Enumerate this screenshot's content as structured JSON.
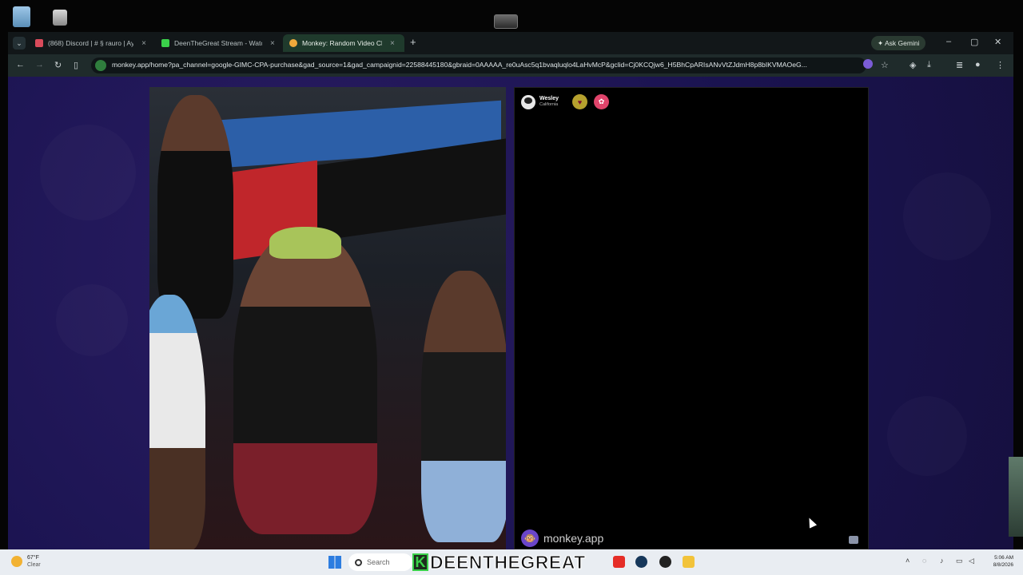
{
  "browser": {
    "tabs": [
      {
        "label": "(868) Discord | # § rauro | Ay..."
      },
      {
        "label": "DeenTheGreat Stream - Watch..."
      },
      {
        "label": "Monkey: Random Video Ch..."
      }
    ],
    "new_tab": "+",
    "ask_gemini": "Ask Gemini",
    "url": "monkey.app/home?pa_channel=google-GIMC-CPA-purchase&gad_source=1&gad_campaignid=22588445180&gbraid=0AAAAA_re0uAsc5q1bvaqluqlo4LaHvMcP&gclid=Cj0KCQjw6_H5BhCpARIsANvVtZJdmH8p8bIKVMAOeG..."
  },
  "call": {
    "peer_name": "Wesley",
    "peer_location": "California",
    "watermark": "monkey.app"
  },
  "taskbar": {
    "temperature": "67°F",
    "condition": "Clear",
    "search_placeholder": "Search",
    "streamer_k": "K",
    "streamer_name": "DEENTHEGREAT",
    "time": "5:06 AM",
    "date": "8/8/2026"
  },
  "colors": {
    "page_bg": "#1a1350",
    "accent_green": "#3ad14a"
  }
}
